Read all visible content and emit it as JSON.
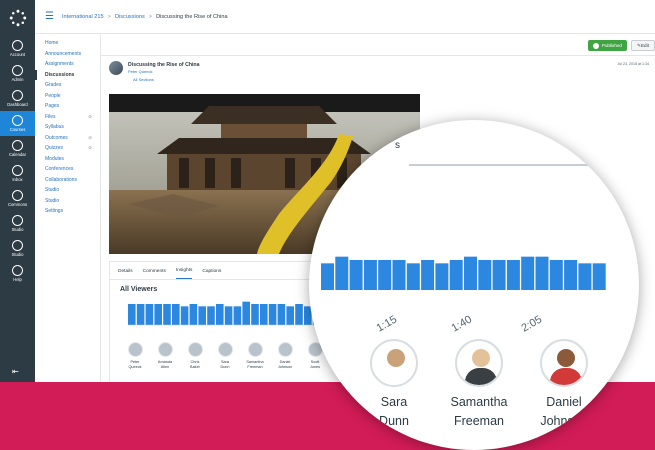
{
  "global_nav": {
    "items": [
      {
        "label": "Account",
        "icon": "account-icon"
      },
      {
        "label": "Admin",
        "icon": "admin-icon"
      },
      {
        "label": "Dashboard",
        "icon": "dashboard-icon"
      },
      {
        "label": "Courses",
        "icon": "courses-icon",
        "active": true
      },
      {
        "label": "Calendar",
        "icon": "calendar-icon"
      },
      {
        "label": "Inbox",
        "icon": "inbox-icon"
      },
      {
        "label": "Commons",
        "icon": "commons-icon"
      },
      {
        "label": "Studio",
        "icon": "studio-icon"
      },
      {
        "label": "Studio",
        "icon": "studio-icon"
      },
      {
        "label": "Help",
        "icon": "help-icon"
      }
    ],
    "collapse_icon": "collapse-icon"
  },
  "breadcrumb": {
    "course": "International 215",
    "section": "Discussions",
    "page": "Discussing the Rise of China",
    "separator": ">"
  },
  "course_nav": {
    "items": [
      {
        "label": "Home"
      },
      {
        "label": "Announcements"
      },
      {
        "label": "Assignments"
      },
      {
        "label": "Discussions",
        "active": true
      },
      {
        "label": "Grades"
      },
      {
        "label": "People"
      },
      {
        "label": "Pages"
      },
      {
        "label": "Files",
        "hidden": true
      },
      {
        "label": "Syllabus"
      },
      {
        "label": "Outcomes",
        "hidden": true
      },
      {
        "label": "Quizzes",
        "hidden": true
      },
      {
        "label": "Modules"
      },
      {
        "label": "Conferences"
      },
      {
        "label": "Collaborations"
      },
      {
        "label": "Studio"
      },
      {
        "label": "Studio"
      },
      {
        "label": "Settings"
      }
    ]
  },
  "toolbar": {
    "published_label": "Published",
    "edit_label": "Edit"
  },
  "post": {
    "title": "Discussing the Rise of China",
    "author": "Peter Queeck",
    "section": "All Sections",
    "date": "Jul 23, 2018 at 1:34"
  },
  "tabs": [
    "Details",
    "Comments",
    "Insights",
    "Captions"
  ],
  "active_tab": "Insights",
  "viewers_title": "All Viewers",
  "people": [
    {
      "first": "Peter",
      "last": "Queeck"
    },
    {
      "first": "Amanda",
      "last": "Allen"
    },
    {
      "first": "Chris",
      "last": "Baker"
    },
    {
      "first": "Sara",
      "last": "Dunn"
    },
    {
      "first": "Samantha",
      "last": "Freeman"
    },
    {
      "first": "Daniel",
      "last": "Johnson"
    },
    {
      "first": "Scott",
      "last": "Jones"
    }
  ],
  "lens": {
    "fragment": "s",
    "people": [
      {
        "first": "Sara",
        "last": "Dunn"
      },
      {
        "first": "Samantha",
        "last": "Freeman"
      },
      {
        "first": "Daniel",
        "last": "Johnson"
      }
    ]
  },
  "colors": {
    "background": "#d21c57",
    "nav": "#2d3b45",
    "accent": "#1d86d8",
    "bar": "#2b87e0",
    "published": "#3fa542"
  },
  "chart_data": {
    "type": "bar",
    "title": "All Viewers",
    "x": [
      "0:00",
      "0:05",
      "0:10",
      "0:15",
      "0:20",
      "0:25",
      "0:30",
      "0:35",
      "0:40",
      "0:45",
      "0:50",
      "0:55",
      "1:00",
      "1:05",
      "1:10",
      "1:15",
      "1:20",
      "1:25",
      "1:30",
      "1:35",
      "1:40",
      "1:45",
      "1:50",
      "1:55",
      "2:00",
      "2:05",
      "2:10",
      "2:15",
      "2:20",
      "2:25",
      "2:30",
      "2:35"
    ],
    "tick_labels": [
      "1:15",
      "1:40",
      "2:05"
    ],
    "values": [
      9,
      9,
      9,
      9,
      9,
      9,
      8,
      9,
      8,
      8,
      9,
      8,
      8,
      10,
      9,
      9,
      9,
      9,
      8,
      9,
      8,
      9,
      10,
      9,
      9,
      9,
      10,
      10,
      9,
      9,
      8,
      8
    ],
    "ylim": [
      0,
      12
    ],
    "grid": false
  }
}
